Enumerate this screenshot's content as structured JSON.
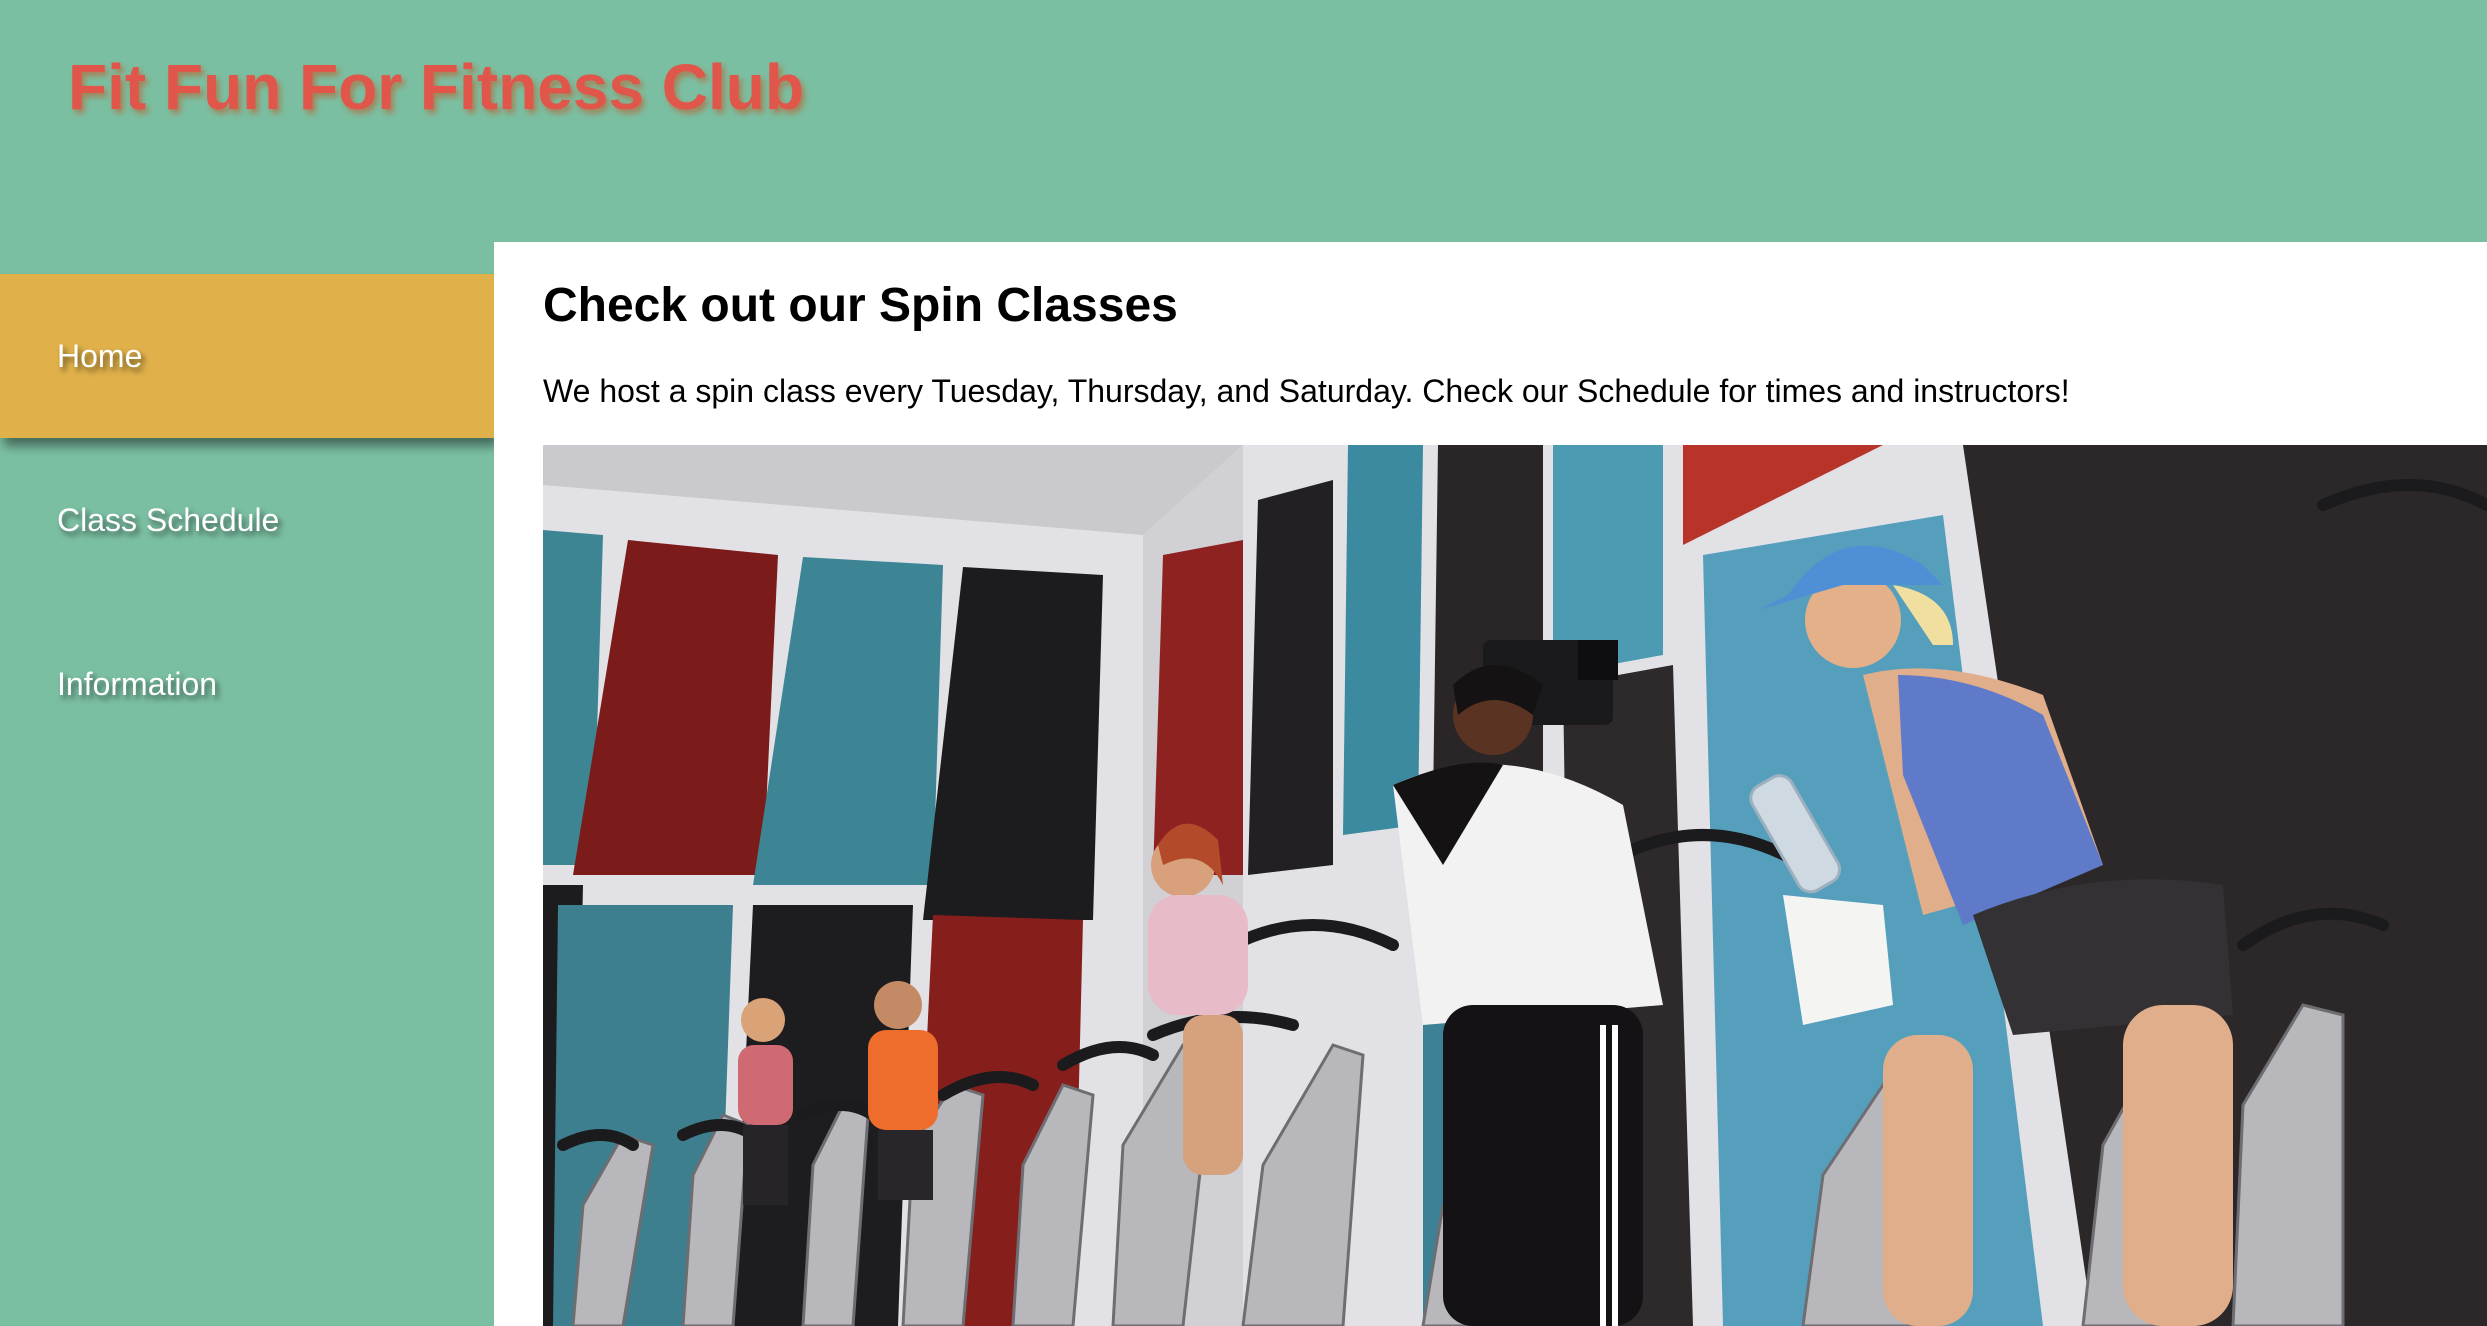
{
  "header": {
    "title": "Fit Fun For Fitness Club"
  },
  "sidebar": {
    "items": [
      {
        "label": "Home",
        "active": true
      },
      {
        "label": "Class Schedule",
        "active": false
      },
      {
        "label": "Information",
        "active": false
      }
    ]
  },
  "main": {
    "heading": "Check out our Spin Classes",
    "description": "We host a spin class every Tuesday, Thursday, and Saturday. Check our Schedule for times and instructors!"
  },
  "colors": {
    "background": "#7bbfa2",
    "title": "#e0564a",
    "active_nav": "#e0b14b",
    "content_bg": "#ffffff"
  }
}
